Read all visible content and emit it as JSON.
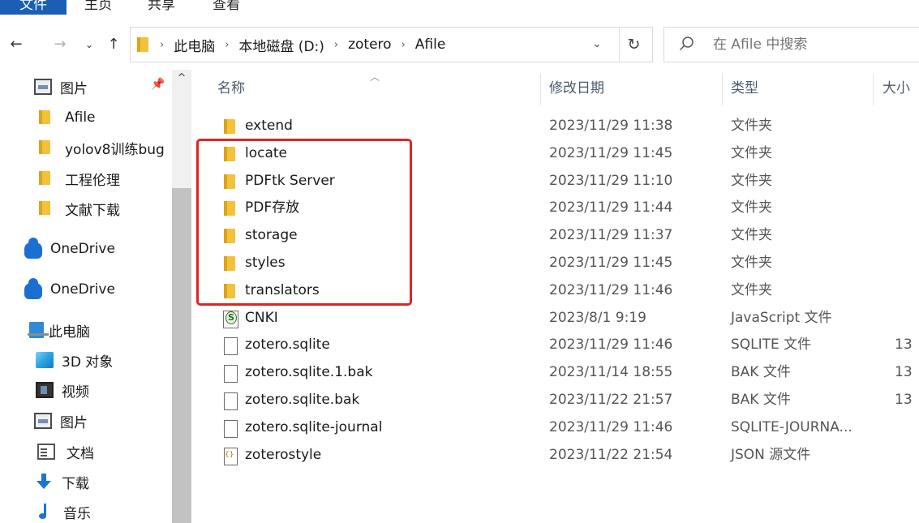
{
  "ribbon": {
    "tabs": [
      {
        "label": "文件",
        "active": true
      },
      {
        "label": "主页",
        "active": false
      },
      {
        "label": "共享",
        "active": false
      },
      {
        "label": "查看",
        "active": false
      }
    ]
  },
  "address": {
    "breadcrumbs": [
      "此电脑",
      "本地磁盘 (D:)",
      "zotero",
      "Afile"
    ]
  },
  "search": {
    "placeholder": "在 Afile 中搜索"
  },
  "nav_pane": {
    "items": [
      {
        "label": "图片",
        "icon": "pictures-icon"
      },
      {
        "label": "Afile",
        "icon": "folder-icon"
      },
      {
        "label": "yolov8训练bug",
        "icon": "folder-icon"
      },
      {
        "label": "工程伦理",
        "icon": "folder-icon"
      },
      {
        "label": "文献下载",
        "icon": "folder-icon"
      },
      {
        "label": "OneDrive",
        "icon": "onedrive-cloud-icon"
      },
      {
        "label": "OneDrive",
        "icon": "onedrive-cloud-icon"
      },
      {
        "label": "此电脑",
        "icon": "this-pc-icon"
      },
      {
        "label": "3D 对象",
        "icon": "3d-objects-icon"
      },
      {
        "label": "视频",
        "icon": "videos-icon"
      },
      {
        "label": "图片",
        "icon": "pictures-icon"
      },
      {
        "label": "文档",
        "icon": "documents-icon"
      },
      {
        "label": "下载",
        "icon": "downloads-icon"
      },
      {
        "label": "音乐",
        "icon": "music-icon"
      }
    ]
  },
  "columns": {
    "name": "名称",
    "date": "修改日期",
    "type": "类型",
    "size": "大小"
  },
  "files": [
    {
      "name": "extend",
      "date": "2023/11/29 11:38",
      "type": "文件夹",
      "size": "",
      "icon": "folder"
    },
    {
      "name": "locate",
      "date": "2023/11/29 11:45",
      "type": "文件夹",
      "size": "",
      "icon": "folder"
    },
    {
      "name": "PDFtk Server",
      "date": "2023/11/29 11:10",
      "type": "文件夹",
      "size": "",
      "icon": "folder"
    },
    {
      "name": "PDF存放",
      "date": "2023/11/29 11:44",
      "type": "文件夹",
      "size": "",
      "icon": "folder"
    },
    {
      "name": "storage",
      "date": "2023/11/29 11:37",
      "type": "文件夹",
      "size": "",
      "icon": "folder"
    },
    {
      "name": "styles",
      "date": "2023/11/29 11:45",
      "type": "文件夹",
      "size": "",
      "icon": "folder"
    },
    {
      "name": "translators",
      "date": "2023/11/29 11:46",
      "type": "文件夹",
      "size": "",
      "icon": "folder"
    },
    {
      "name": "CNKI",
      "date": "2023/8/1 9:19",
      "type": "JavaScript 文件",
      "size": "",
      "icon": "js"
    },
    {
      "name": "zotero.sqlite",
      "date": "2023/11/29 11:46",
      "type": "SQLITE 文件",
      "size": "13",
      "icon": "file"
    },
    {
      "name": "zotero.sqlite.1.bak",
      "date": "2023/11/14 18:55",
      "type": "BAK 文件",
      "size": "13",
      "icon": "file"
    },
    {
      "name": "zotero.sqlite.bak",
      "date": "2023/11/22 21:57",
      "type": "BAK 文件",
      "size": "13",
      "icon": "file"
    },
    {
      "name": "zotero.sqlite-journal",
      "date": "2023/11/29 11:46",
      "type": "SQLITE-JOURNA...",
      "size": "",
      "icon": "file"
    },
    {
      "name": "zoterostyle",
      "date": "2023/11/22 21:54",
      "type": "JSON 源文件",
      "size": "",
      "icon": "json"
    }
  ],
  "highlight": {
    "color": "#e02424"
  }
}
